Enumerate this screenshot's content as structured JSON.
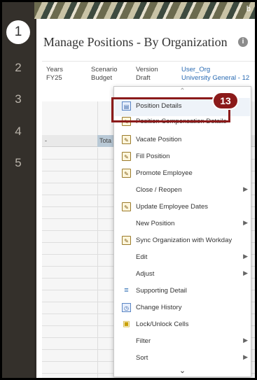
{
  "banner": {
    "corner_text": "b"
  },
  "steps": [
    "1",
    "2",
    "3",
    "4",
    "5"
  ],
  "page": {
    "title": "Manage Positions - By Organization",
    "info_icon": "i"
  },
  "pov": [
    {
      "label": "Years",
      "value": "FY25"
    },
    {
      "label": "Scenario",
      "value": "Budget"
    },
    {
      "label": "Version",
      "value": "Draft"
    },
    {
      "label": "User_Org",
      "value": "University General - 12"
    }
  ],
  "grid": {
    "col1": "-",
    "col2": "Tota"
  },
  "menu": {
    "items": [
      {
        "label": "Position Details",
        "icon": "details-icon",
        "submenu": false
      },
      {
        "label": "Position Compensation Details",
        "icon": "",
        "submenu": false
      },
      {
        "label": "Vacate Position",
        "icon": "form-icon",
        "submenu": false
      },
      {
        "label": "Fill Position",
        "icon": "form-icon",
        "submenu": false
      },
      {
        "label": "Promote Employee",
        "icon": "form-icon",
        "submenu": false
      },
      {
        "label": "Close / Reopen",
        "icon": "",
        "submenu": true
      },
      {
        "label": "Update Employee Dates",
        "icon": "form-icon",
        "submenu": false
      },
      {
        "label": "New Position",
        "icon": "",
        "submenu": true
      },
      {
        "label": "Sync Organization with Workday",
        "icon": "form-icon",
        "submenu": false
      },
      {
        "label": "Edit",
        "icon": "",
        "submenu": true
      },
      {
        "label": "Adjust",
        "icon": "",
        "submenu": true
      },
      {
        "label": "Supporting Detail",
        "icon": "supporting-detail-icon",
        "submenu": false
      },
      {
        "label": "Change History",
        "icon": "history-icon",
        "submenu": false
      },
      {
        "label": "Lock/Unlock Cells",
        "icon": "lock-icon",
        "submenu": false
      },
      {
        "label": "Filter",
        "icon": "",
        "submenu": true
      },
      {
        "label": "Sort",
        "icon": "",
        "submenu": true
      }
    ]
  },
  "annotation": {
    "step_number": "13"
  },
  "colors": {
    "annotation": "#8b1a1a",
    "rail": "#34302b",
    "link": "#2a6bb3"
  }
}
